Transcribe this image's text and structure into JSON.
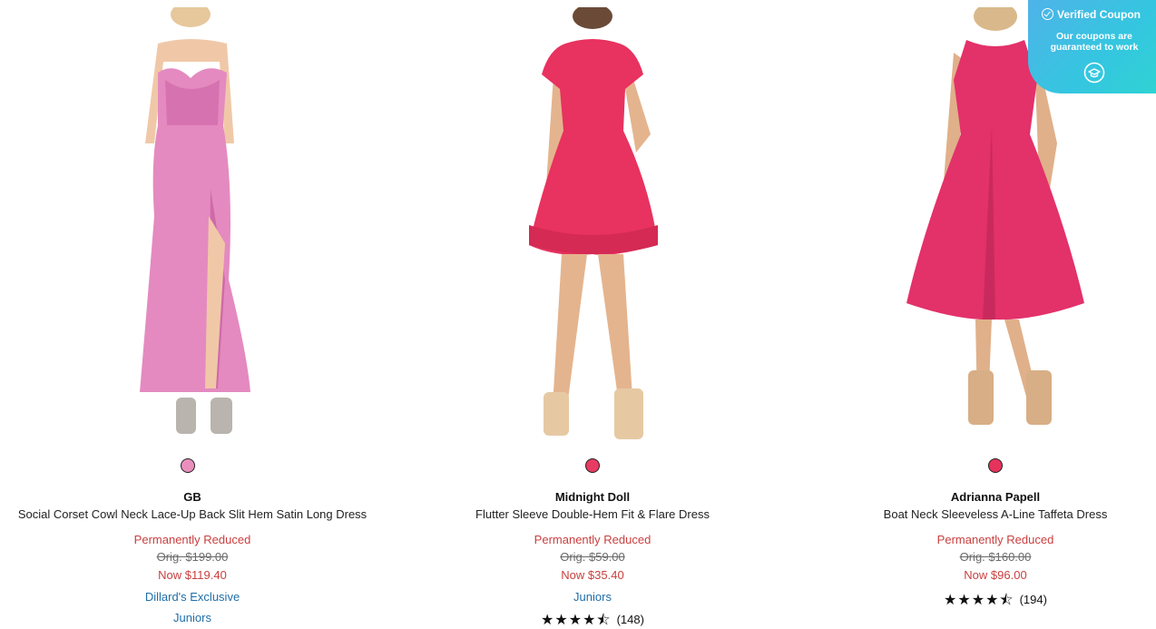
{
  "coupon": {
    "title": "Verified Coupon",
    "subtitle": "Our coupons are guaranteed to work"
  },
  "products": [
    {
      "swatch_color": "#ea8fbd",
      "brand": "GB",
      "name": "Social Corset Cowl Neck Lace-Up Back Slit Hem Satin Long Dress",
      "badge": "Permanently Reduced",
      "orig": "Orig. $199.00",
      "now": "Now $119.40",
      "tags": [
        "Dillard's Exclusive",
        "Juniors"
      ]
    },
    {
      "swatch_color": "#e83b63",
      "brand": "Midnight Doll",
      "name": "Flutter Sleeve Double-Hem Fit & Flare Dress",
      "badge": "Permanently Reduced",
      "orig": "Orig. $59.00",
      "now": "Now $35.40",
      "tags": [
        "Juniors"
      ],
      "rating": 4.5,
      "rating_stars": "★★★★⯪",
      "reviews": "(148)"
    },
    {
      "swatch_color": "#e6335c",
      "brand": "Adrianna Papell",
      "name": "Boat Neck Sleeveless A-Line Taffeta Dress",
      "badge": "Permanently Reduced",
      "orig": "Orig. $160.00",
      "now": "Now $96.00",
      "tags": [],
      "rating": 4.5,
      "rating_stars": "★★★★⯪",
      "reviews": "(194)"
    }
  ],
  "colors": {
    "sale_red": "#c9403f",
    "link_blue": "#1f6ea8",
    "coupon_gradient": [
      "#4fb3e8",
      "#2fd3d3"
    ]
  }
}
